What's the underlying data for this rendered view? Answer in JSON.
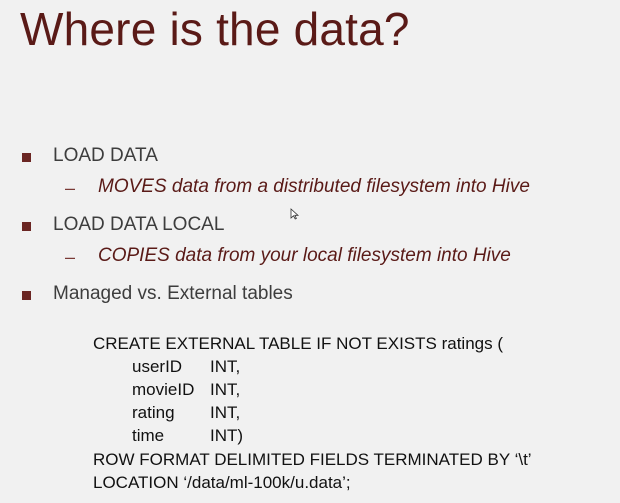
{
  "title": "Where is the data?",
  "bullets": [
    {
      "text": "LOAD DATA",
      "sub": "MOVES data from a distributed filesystem into Hive"
    },
    {
      "text": "LOAD DATA LOCAL",
      "sub": "COPIES data from your local filesystem into Hive"
    },
    {
      "text": "Managed vs. External tables"
    }
  ],
  "dash": "–",
  "code": {
    "line1": "CREATE EXTERNAL TABLE IF NOT EXISTS ratings (",
    "columns": [
      {
        "name": "userID",
        "type": "INT,"
      },
      {
        "name": "movieID",
        "type": "INT,"
      },
      {
        "name": "rating",
        "type": "INT,"
      },
      {
        "name": "time",
        "type": "INT)"
      }
    ],
    "line_row_format": "ROW FORMAT DELIMITED FIELDS TERMINATED BY ‘\\t’",
    "line_location": "LOCATION ‘/data/ml-100k/u.data’;"
  },
  "colors": {
    "title": "#5a1a17",
    "bullet": "#6b2623",
    "body_text": "#3d3d3d",
    "background": "#f1f1f1"
  },
  "icons": {
    "cursor": "mouse-pointer-icon"
  }
}
